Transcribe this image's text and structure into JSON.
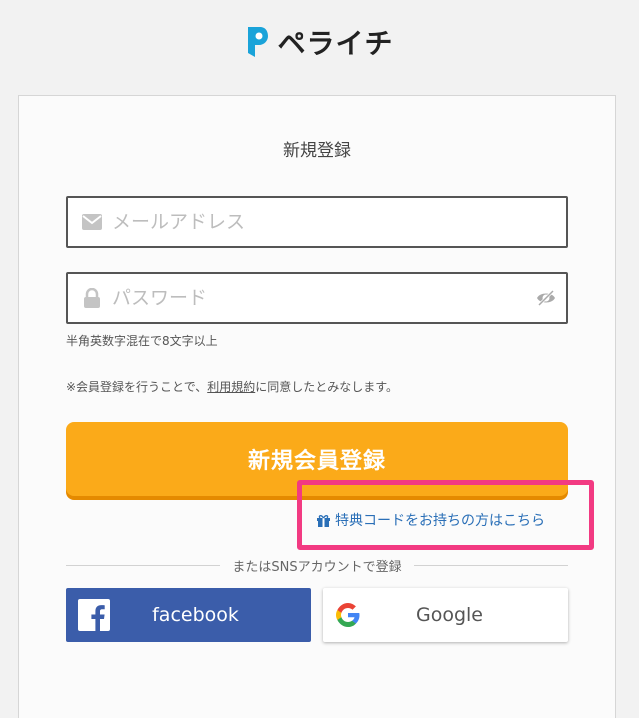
{
  "brand": {
    "name": "ペライチ"
  },
  "form": {
    "title": "新規登録",
    "email_placeholder": "メールアドレス",
    "password_placeholder": "パスワード",
    "password_hint": "半角英数字混在で8文字以上",
    "terms_prefix": "※会員登録を行うことで、",
    "terms_link": "利用規約",
    "terms_suffix": "に同意したとみなします。",
    "register_label": "新規会員登録",
    "promo_label": "特典コードをお持ちの方はこちら"
  },
  "sns": {
    "divider_label": "またはSNSアカウントで登録",
    "facebook_label": "facebook",
    "google_label": "Google"
  },
  "colors": {
    "accent": "#fbaa19",
    "highlight": "#f23a82",
    "link": "#2a6fb7",
    "facebook": "#3b5daa",
    "logo": "#1aa3d9"
  }
}
